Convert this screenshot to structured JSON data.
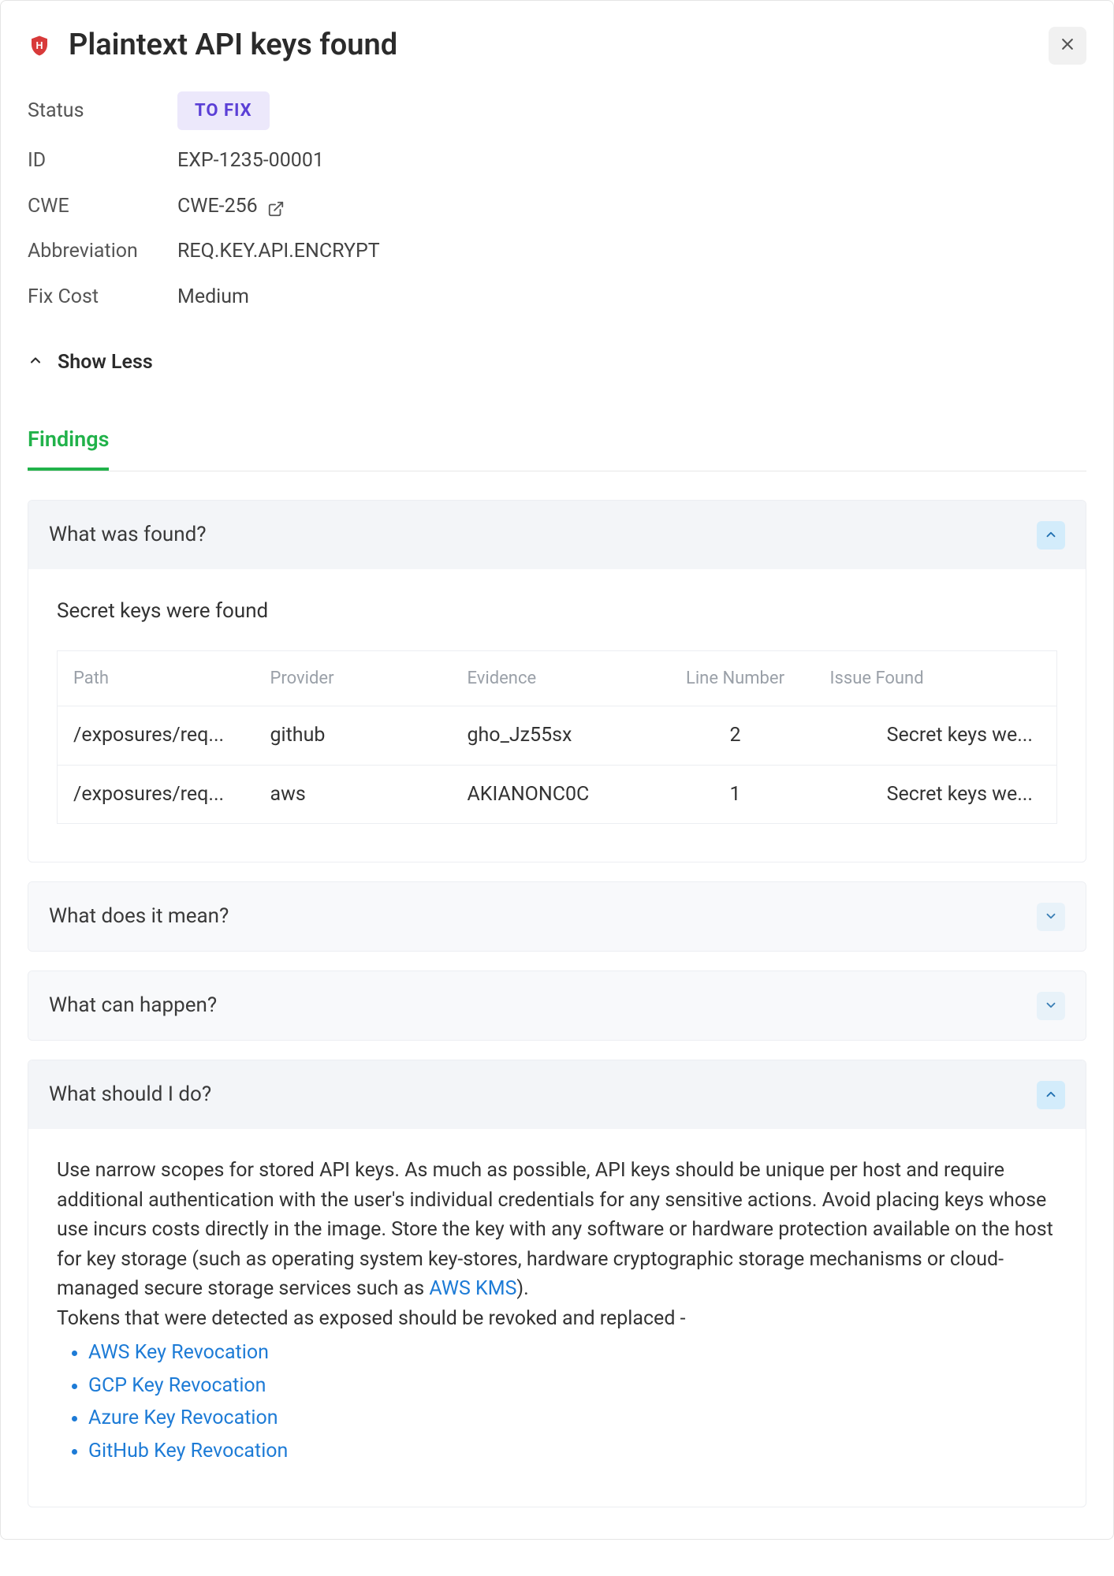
{
  "header": {
    "title": "Plaintext API keys found"
  },
  "meta": {
    "status_label": "Status",
    "status_value": "TO FIX",
    "id_label": "ID",
    "id_value": "EXP-1235-00001",
    "cwe_label": "CWE",
    "cwe_value": "CWE-256",
    "abbr_label": "Abbreviation",
    "abbr_value": "REQ.KEY.API.ENCRYPT",
    "cost_label": "Fix Cost",
    "cost_value": "Medium"
  },
  "showless": "Show Less",
  "tabs": {
    "findings": "Findings"
  },
  "acc1": {
    "title": "What was found?",
    "summary": "Secret keys were found",
    "columns": [
      "Path",
      "Provider",
      "Evidence",
      "Line Number",
      "Issue Found"
    ],
    "rows": [
      {
        "path": "/exposures/req...",
        "provider": "github",
        "evidence": "gho_Jz55sx",
        "line": "2",
        "issue": "Secret keys we..."
      },
      {
        "path": "/exposures/req...",
        "provider": "aws",
        "evidence": "AKIANONC0C",
        "line": "1",
        "issue": "Secret keys we..."
      }
    ]
  },
  "acc2": {
    "title": "What does it mean?"
  },
  "acc3": {
    "title": "What can happen?"
  },
  "acc4": {
    "title": "What should I do?",
    "body_pre": "Use narrow scopes for stored API keys. As much as possible, API keys should be unique per host and require additional authentication with the user's individual credentials for any sensitive actions. Avoid placing keys whose use incurs costs directly in the image. Store the key with any software or hardware protection available on the host for key storage (such as operating system key-stores, hardware cryptographic storage mechanisms or cloud-managed secure storage services such as ",
    "link_aws_kms": "AWS KMS",
    "body_post": ").",
    "revoke_intro": "Tokens that were detected as exposed should be revoked and replaced -",
    "links": [
      "AWS Key Revocation",
      "GCP Key Revocation",
      "Azure Key Revocation",
      "GitHub Key Revocation"
    ]
  }
}
